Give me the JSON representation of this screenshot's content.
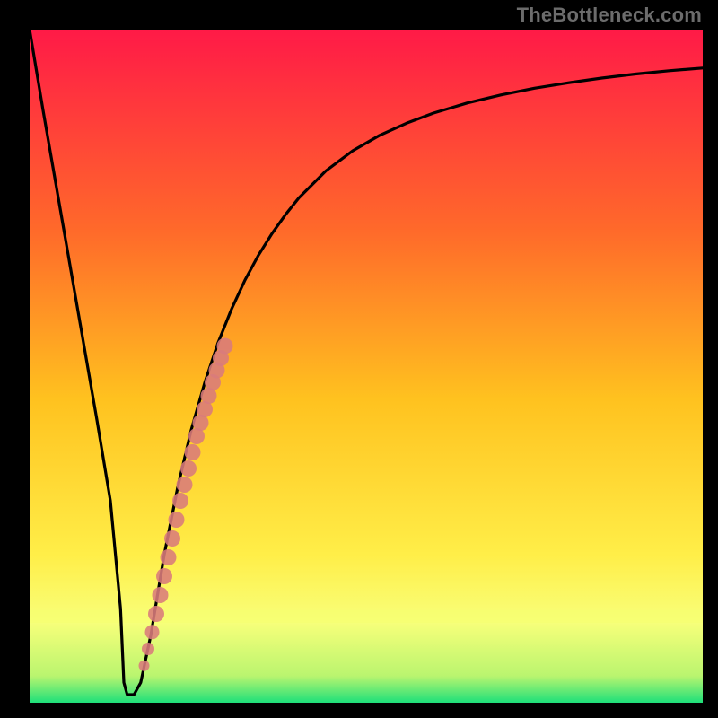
{
  "watermark": "TheBottleneck.com",
  "colors": {
    "frame": "#000000",
    "curve": "#000000",
    "dots": "#d97b7b",
    "gradient_top": "#ff1a47",
    "gradient_mid1": "#ff6a2a",
    "gradient_mid2": "#ffc21f",
    "gradient_mid3": "#ffee48",
    "gradient_band": "#f8ff7a",
    "gradient_green": "#1ee07a"
  },
  "chart_data": {
    "type": "line",
    "title": "",
    "xlabel": "",
    "ylabel": "",
    "xlim": [
      0,
      100
    ],
    "ylim": [
      0,
      100
    ],
    "series": [
      {
        "name": "curve",
        "x": [
          0,
          2,
          4,
          6,
          8,
          10,
          12,
          13.5,
          14,
          14.5,
          15,
          15.5,
          16.5,
          18,
          20,
          22,
          24,
          26,
          28,
          30,
          32,
          34,
          36,
          38,
          40,
          44,
          48,
          52,
          56,
          60,
          65,
          70,
          75,
          80,
          85,
          90,
          95,
          100
        ],
        "y": [
          100,
          88,
          76.5,
          65,
          53.5,
          42,
          30,
          14,
          3,
          1.2,
          1.2,
          1.2,
          3,
          10,
          22,
          32,
          40.5,
          47.5,
          53.5,
          58.5,
          62.8,
          66.5,
          69.7,
          72.5,
          75,
          79,
          82,
          84.3,
          86.1,
          87.6,
          89.1,
          90.3,
          91.3,
          92.1,
          92.8,
          93.4,
          93.9,
          94.3
        ]
      }
    ],
    "dots": {
      "x": [
        17.0,
        17.6,
        18.2,
        18.8,
        19.4,
        20.0,
        20.6,
        21.2,
        21.8,
        22.4,
        23.0,
        23.6,
        24.2,
        24.8,
        25.4,
        26.0,
        26.6,
        27.2,
        27.8,
        28.4,
        29.0
      ],
      "y": [
        5.5,
        8.0,
        10.5,
        13.2,
        16.0,
        18.8,
        21.6,
        24.4,
        27.2,
        30.0,
        32.4,
        34.8,
        37.2,
        39.6,
        41.6,
        43.6,
        45.6,
        47.6,
        49.4,
        51.2,
        53.0
      ],
      "r": [
        6,
        7,
        8,
        9,
        9,
        9,
        9,
        9,
        9,
        9,
        9,
        9,
        9,
        9,
        9,
        9,
        9,
        9,
        9,
        9,
        9
      ]
    }
  }
}
